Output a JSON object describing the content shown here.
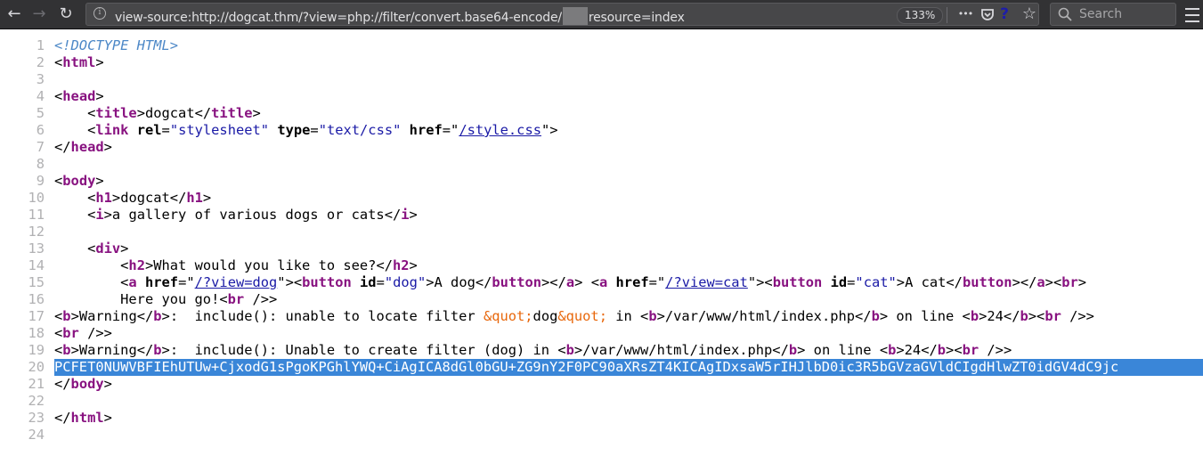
{
  "browser": {
    "nav": {
      "back": "←",
      "forward": "→",
      "reload": "↻"
    },
    "url": {
      "prefix": "view-source:http://dogcat.thm/?view=php://filter/convert.base64-encode/",
      "suffix": "resource=index",
      "redacted": true
    },
    "zoom_level": "133%",
    "page_actions": {
      "more": "•••",
      "pocket": "pocket-icon",
      "help": "?",
      "bookmark": "☆"
    },
    "search_placeholder": "Search",
    "colors": {
      "toolbar": "#323234",
      "urlbar": "#474749",
      "selection": "#3a86d8",
      "help_icon": "#1d1daa"
    }
  },
  "source_lines": [
    {
      "n": "1"
    },
    {
      "n": "2"
    },
    {
      "n": "3"
    },
    {
      "n": "4"
    },
    {
      "n": "5"
    },
    {
      "n": "6"
    },
    {
      "n": "7"
    },
    {
      "n": "8"
    },
    {
      "n": "9"
    },
    {
      "n": "10"
    },
    {
      "n": "11"
    },
    {
      "n": "12"
    },
    {
      "n": "13"
    },
    {
      "n": "14"
    },
    {
      "n": "15"
    },
    {
      "n": "16"
    },
    {
      "n": "17"
    },
    {
      "n": "18"
    },
    {
      "n": "19"
    },
    {
      "n": "20"
    },
    {
      "n": "21"
    },
    {
      "n": "22"
    },
    {
      "n": "23"
    },
    {
      "n": "24"
    }
  ],
  "tokens": {
    "doctype": "<!DOCTYPE HTML>",
    "lt": "<",
    "gt": ">",
    "lts": "</",
    "eq": "=",
    "q": "\"",
    "selfclose": " />",
    "indent4": "    ",
    "indent8": "        ",
    "html": "html",
    "head": "head",
    "title": "title",
    "link": "link",
    "body": "body",
    "h1": "h1",
    "i": "i",
    "div": "div",
    "h2": "h2",
    "a": "a",
    "button": "button",
    "br": "br",
    "b": "b",
    "rel": "rel",
    "type": "type",
    "href": "href",
    "id": "id",
    "v_stylesheet": "stylesheet",
    "v_textcss": "text/css",
    "v_stylecss": "/style.css",
    "v_viewdog": "/?view=dog",
    "v_viewcat": "/?view=cat",
    "v_dog": "dog",
    "v_cat": "cat",
    "t_dogcat": "dogcat",
    "t_gallery": "a gallery of various dogs or cats",
    "t_whatsee": "What would you like to see?",
    "t_adog": "A dog",
    "t_acat": "A cat",
    "t_hereyougo": "Here you go!",
    "t_warning": "Warning",
    "t_warn1_a": ":  include(): unable to locate filter ",
    "t_quot": "&quot;",
    "t_dogword": "dog",
    "t_in": " in ",
    "t_path": "/var/www/html/index.php",
    "t_online": " on line ",
    "t_24": "24",
    "t_warn2_a": ":  include(): Unable to create filter (dog) in ",
    "t_space": " ",
    "base64": "PCFET0NUWVBFIEhUTUw+CjxodG1sPgoKPGhlYWQ+CiAgICA8dGl0bGU+ZG9nY2F0PC90aXRsZT4KICAgIDxsaW5rIHJlbD0ic3R5bGVzaGVldCIgdHlwZT0idGV4dC9jc"
  }
}
